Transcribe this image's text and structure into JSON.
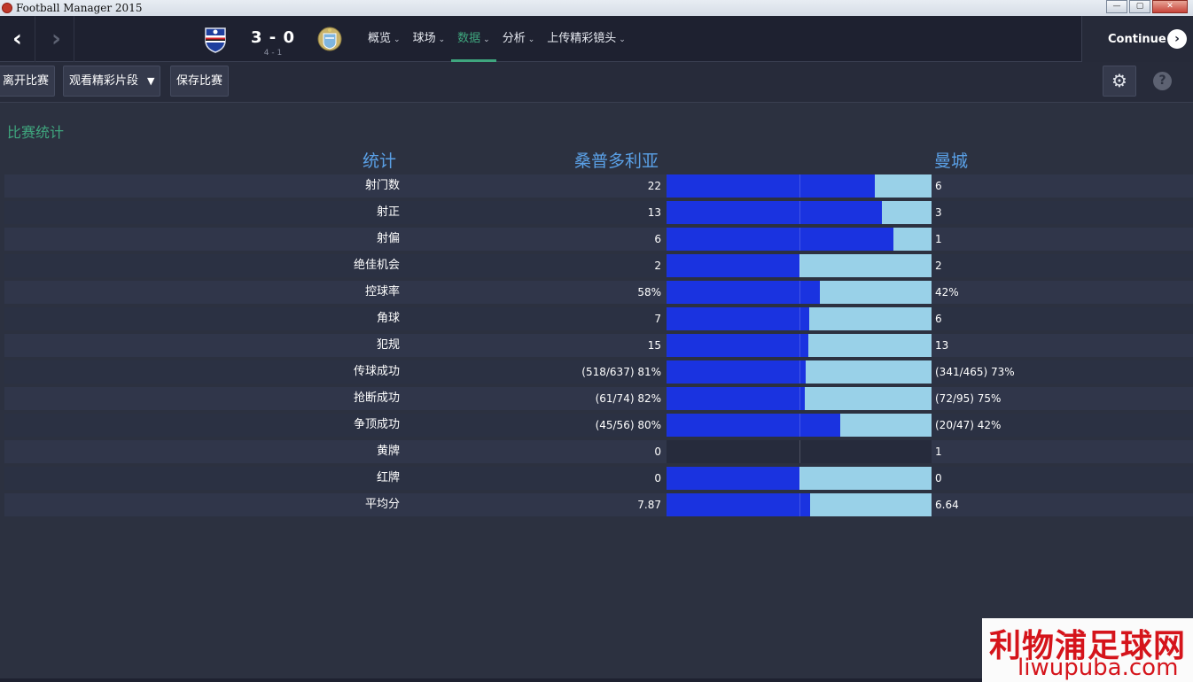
{
  "window": {
    "title": "Football Manager 2015",
    "controls": [
      "—",
      "▢",
      "✕"
    ]
  },
  "nav": {
    "back_icon": "chevron-left-icon",
    "forward_icon": "chevron-right-icon",
    "score": "3 - 0",
    "score_sub": "4 - 1",
    "home_badge": "sampdoria-crest",
    "away_badge": "man-city-crest",
    "menu": [
      {
        "label": "概览"
      },
      {
        "label": "球场"
      },
      {
        "label": "数据",
        "active": true
      },
      {
        "label": "分析"
      },
      {
        "label": "上传精彩镜头"
      }
    ],
    "continue_label": "Continue"
  },
  "toolbar": {
    "leave_label": "离开比赛",
    "highlights_label": "观看精彩片段",
    "save_label": "保存比赛"
  },
  "stats": {
    "section_title": "比赛统计",
    "header_stat": "统计",
    "header_home": "桑普多利亚",
    "header_away": "曼城",
    "colors": {
      "home": "#1a33e0",
      "away": "#99d1e8",
      "accent": "#3fa67e",
      "header": "#5aa0e6"
    },
    "rows": [
      {
        "label": "射门数",
        "home": "22",
        "away": "6",
        "home_share": 0.786
      },
      {
        "label": "射正",
        "home": "13",
        "away": "3",
        "home_share": 0.8125
      },
      {
        "label": "射偏",
        "home": "6",
        "away": "1",
        "home_share": 0.857
      },
      {
        "label": "绝佳机会",
        "home": "2",
        "away": "2",
        "home_share": 0.5
      },
      {
        "label": "控球率",
        "home": "58%",
        "away": "42%",
        "home_share": 0.58
      },
      {
        "label": "角球",
        "home": "7",
        "away": "6",
        "home_share": 0.538
      },
      {
        "label": "犯规",
        "home": "15",
        "away": "13",
        "home_share": 0.536
      },
      {
        "label": "传球成功",
        "home": "(518/637) 81%",
        "away": "(341/465) 73%",
        "home_share": 0.526
      },
      {
        "label": "抢断成功",
        "home": "(61/74) 82%",
        "away": "(72/95) 75%",
        "home_share": 0.522
      },
      {
        "label": "争顶成功",
        "home": "(45/56) 80%",
        "away": "(20/47) 42%",
        "home_share": 0.656
      },
      {
        "label": "黄牌",
        "home": "0",
        "away": "1",
        "home_share": null
      },
      {
        "label": "红牌",
        "home": "0",
        "away": "0",
        "home_share": 0.5
      },
      {
        "label": "平均分",
        "home": "7.87",
        "away": "6.64",
        "home_share": 0.542
      }
    ]
  },
  "watermark": {
    "cn": "利物浦足球网",
    "url": "liwupuba.com"
  }
}
